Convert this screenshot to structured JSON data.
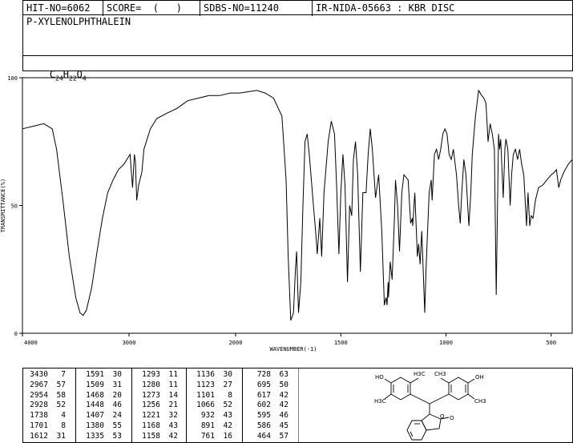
{
  "header": {
    "hit_no": "HIT-NO=6062",
    "score": "SCORE=  (   )",
    "sdbs_no": "SDBS-NO=11240",
    "ir_nida": "IR-NIDA-05663 : KBR DISC"
  },
  "compound": {
    "name": "P-XYLENOLPHTHALEIN",
    "formula_c": "C",
    "formula_c_sub": "24",
    "formula_h": "H",
    "formula_h_sub": "22",
    "formula_o": "O",
    "formula_o_sub": "4"
  },
  "chart_data": {
    "type": "line",
    "xlabel": "WAVENUMBER(-1)",
    "ylabel": "TRANSMITTANCE(%)",
    "xlim": [
      4000,
      400
    ],
    "ylim": [
      0,
      100
    ],
    "x_ticks": [
      "4000",
      "3000",
      "2000",
      "1500",
      "1000",
      "500"
    ],
    "y_ticks": [
      "100",
      "50",
      "0"
    ],
    "series": [
      {
        "points": [
          [
            4000,
            80
          ],
          [
            3900,
            81
          ],
          [
            3800,
            82
          ],
          [
            3720,
            80
          ],
          [
            3680,
            72
          ],
          [
            3620,
            52
          ],
          [
            3560,
            30
          ],
          [
            3500,
            14
          ],
          [
            3460,
            8
          ],
          [
            3430,
            7
          ],
          [
            3400,
            9
          ],
          [
            3350,
            18
          ],
          [
            3300,
            32
          ],
          [
            3250,
            45
          ],
          [
            3200,
            55
          ],
          [
            3150,
            60
          ],
          [
            3100,
            64
          ],
          [
            3050,
            66
          ],
          [
            3020,
            68
          ],
          [
            2990,
            70
          ],
          [
            2967,
            57
          ],
          [
            2950,
            70
          ],
          [
            2940,
            67
          ],
          [
            2928,
            52
          ],
          [
            2910,
            58
          ],
          [
            2880,
            63
          ],
          [
            2860,
            72
          ],
          [
            2800,
            80
          ],
          [
            2740,
            84
          ],
          [
            2650,
            86
          ],
          [
            2550,
            88
          ],
          [
            2450,
            91
          ],
          [
            2350,
            92
          ],
          [
            2250,
            93
          ],
          [
            2150,
            93
          ],
          [
            2050,
            94
          ],
          [
            1980,
            94
          ],
          [
            1900,
            95
          ],
          [
            1860,
            94
          ],
          [
            1820,
            92
          ],
          [
            1780,
            85
          ],
          [
            1760,
            60
          ],
          [
            1750,
            30
          ],
          [
            1738,
            5
          ],
          [
            1725,
            8
          ],
          [
            1715,
            26
          ],
          [
            1710,
            32
          ],
          [
            1701,
            8
          ],
          [
            1690,
            20
          ],
          [
            1680,
            50
          ],
          [
            1670,
            75
          ],
          [
            1660,
            78
          ],
          [
            1650,
            70
          ],
          [
            1640,
            60
          ],
          [
            1630,
            50
          ],
          [
            1620,
            40
          ],
          [
            1612,
            31
          ],
          [
            1600,
            45
          ],
          [
            1591,
            30
          ],
          [
            1580,
            55
          ],
          [
            1560,
            75
          ],
          [
            1545,
            83
          ],
          [
            1530,
            78
          ],
          [
            1520,
            58
          ],
          [
            1509,
            31
          ],
          [
            1500,
            55
          ],
          [
            1490,
            70
          ],
          [
            1480,
            58
          ],
          [
            1468,
            20
          ],
          [
            1458,
            50
          ],
          [
            1448,
            46
          ],
          [
            1440,
            68
          ],
          [
            1430,
            75
          ],
          [
            1420,
            62
          ],
          [
            1407,
            24
          ],
          [
            1395,
            55
          ],
          [
            1380,
            55
          ],
          [
            1370,
            70
          ],
          [
            1360,
            80
          ],
          [
            1350,
            72
          ],
          [
            1335,
            53
          ],
          [
            1320,
            62
          ],
          [
            1305,
            40
          ],
          [
            1293,
            11
          ],
          [
            1285,
            14
          ],
          [
            1280,
            11
          ],
          [
            1275,
            20
          ],
          [
            1273,
            14
          ],
          [
            1265,
            28
          ],
          [
            1256,
            21
          ],
          [
            1245,
            45
          ],
          [
            1240,
            60
          ],
          [
            1230,
            50
          ],
          [
            1221,
            32
          ],
          [
            1210,
            55
          ],
          [
            1200,
            62
          ],
          [
            1180,
            60
          ],
          [
            1168,
            43
          ],
          [
            1160,
            45
          ],
          [
            1158,
            42
          ],
          [
            1148,
            55
          ],
          [
            1140,
            38
          ],
          [
            1136,
            30
          ],
          [
            1130,
            35
          ],
          [
            1123,
            27
          ],
          [
            1115,
            40
          ],
          [
            1101,
            8
          ],
          [
            1095,
            25
          ],
          [
            1080,
            55
          ],
          [
            1070,
            60
          ],
          [
            1066,
            52
          ],
          [
            1055,
            70
          ],
          [
            1045,
            72
          ],
          [
            1035,
            68
          ],
          [
            1025,
            72
          ],
          [
            1015,
            78
          ],
          [
            1005,
            80
          ],
          [
            995,
            78
          ],
          [
            985,
            70
          ],
          [
            975,
            68
          ],
          [
            965,
            72
          ],
          [
            950,
            62
          ],
          [
            940,
            50
          ],
          [
            932,
            43
          ],
          [
            925,
            55
          ],
          [
            915,
            68
          ],
          [
            905,
            62
          ],
          [
            891,
            42
          ],
          [
            882,
            55
          ],
          [
            875,
            70
          ],
          [
            860,
            85
          ],
          [
            845,
            95
          ],
          [
            830,
            93
          ],
          [
            820,
            92
          ],
          [
            810,
            90
          ],
          [
            800,
            75
          ],
          [
            790,
            82
          ],
          [
            780,
            78
          ],
          [
            770,
            72
          ],
          [
            761,
            15
          ],
          [
            755,
            50
          ],
          [
            750,
            78
          ],
          [
            745,
            72
          ],
          [
            740,
            76
          ],
          [
            728,
            53
          ],
          [
            720,
            72
          ],
          [
            715,
            76
          ],
          [
            706,
            72
          ],
          [
            695,
            50
          ],
          [
            688,
            62
          ],
          [
            680,
            70
          ],
          [
            670,
            72
          ],
          [
            660,
            68
          ],
          [
            650,
            72
          ],
          [
            640,
            66
          ],
          [
            630,
            62
          ],
          [
            617,
            42
          ],
          [
            610,
            55
          ],
          [
            602,
            42
          ],
          [
            595,
            46
          ],
          [
            586,
            45
          ],
          [
            575,
            52
          ],
          [
            560,
            57
          ],
          [
            540,
            58
          ],
          [
            520,
            60
          ],
          [
            500,
            62
          ],
          [
            485,
            63
          ],
          [
            475,
            64
          ],
          [
            464,
            57
          ],
          [
            455,
            60
          ],
          [
            440,
            63
          ],
          [
            420,
            66
          ],
          [
            400,
            68
          ]
        ]
      }
    ],
    "peaks": [
      [
        "3430",
        "7"
      ],
      [
        "2967",
        "57"
      ],
      [
        "2954",
        "58"
      ],
      [
        "2928",
        "52"
      ],
      [
        "1738",
        "4"
      ],
      [
        "1701",
        "8"
      ],
      [
        "1612",
        "31"
      ],
      [
        "1591",
        "30"
      ],
      [
        "1509",
        "31"
      ],
      [
        "1468",
        "20"
      ],
      [
        "1448",
        "46"
      ],
      [
        "1407",
        "24"
      ],
      [
        "1380",
        "55"
      ],
      [
        "1335",
        "53"
      ],
      [
        "1293",
        "11"
      ],
      [
        "1280",
        "11"
      ],
      [
        "1273",
        "14"
      ],
      [
        "1256",
        "21"
      ],
      [
        "1221",
        "32"
      ],
      [
        "1168",
        "43"
      ],
      [
        "1158",
        "42"
      ],
      [
        "1136",
        "30"
      ],
      [
        "1123",
        "27"
      ],
      [
        "1101",
        "8"
      ],
      [
        "1066",
        "52"
      ],
      [
        "932",
        "43"
      ],
      [
        "891",
        "42"
      ],
      [
        "761",
        "16"
      ],
      [
        "728",
        "63"
      ],
      [
        "695",
        "50"
      ],
      [
        "617",
        "42"
      ],
      [
        "602",
        "42"
      ],
      [
        "595",
        "46"
      ],
      [
        "586",
        "45"
      ],
      [
        "464",
        "57"
      ]
    ]
  },
  "structure": {
    "labels": [
      "HO",
      "OH",
      "H3C",
      "CH3",
      "H3C",
      "CH3",
      "O",
      "O"
    ]
  }
}
